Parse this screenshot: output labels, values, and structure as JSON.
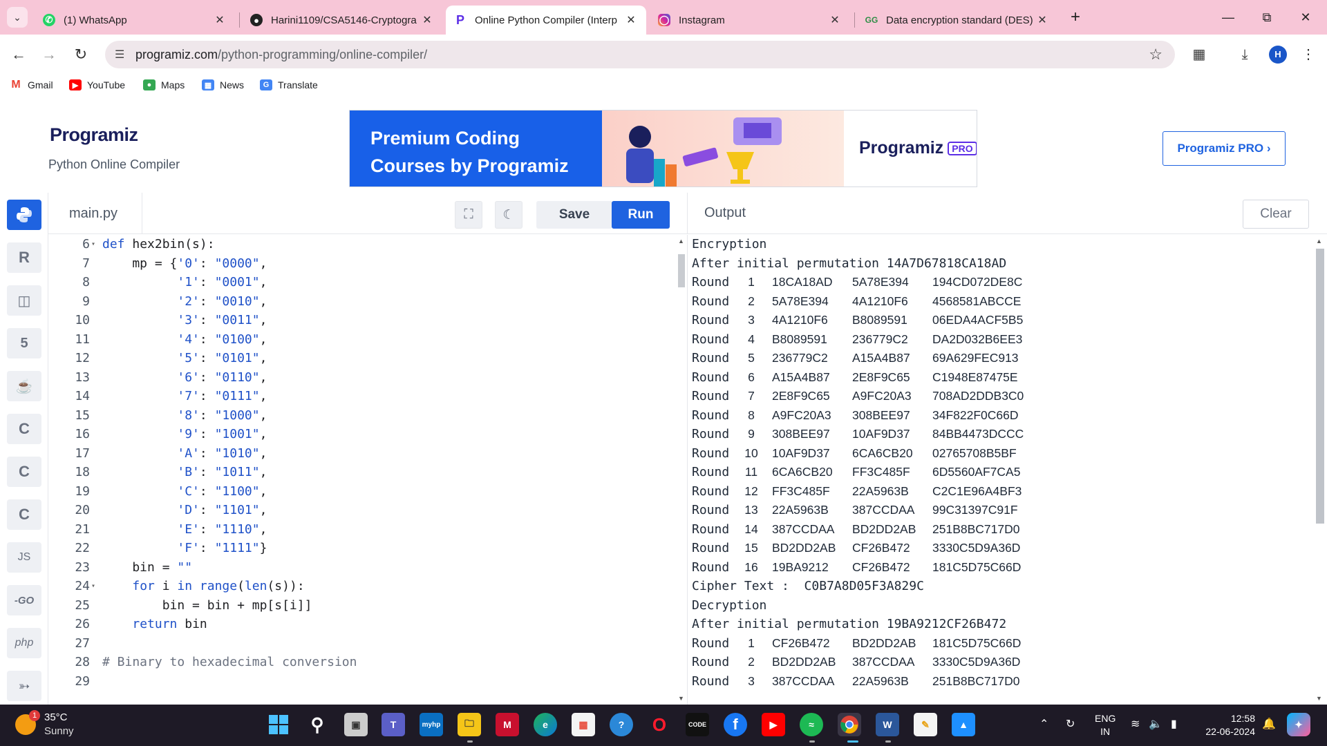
{
  "browser": {
    "tabs": [
      {
        "title": "(1) WhatsApp",
        "icon": "whatsapp-icon"
      },
      {
        "title": "Harini1109/CSA5146-Cryptogra",
        "icon": "github-icon"
      },
      {
        "title": "Online Python Compiler (Interp",
        "icon": "programiz-icon"
      },
      {
        "title": "Instagram",
        "icon": "instagram-icon"
      },
      {
        "title": "Data encryption standard (DES)",
        "icon": "geeks-icon"
      }
    ],
    "url_host": "programiz.com",
    "url_path": "/python-programming/online-compiler/",
    "profile_initial": "H",
    "bookmarks": [
      "Gmail",
      "YouTube",
      "Maps",
      "News",
      "Translate"
    ]
  },
  "header": {
    "logo": "Programiz",
    "subtitle": "Python Online Compiler",
    "banner_line1": "Premium Coding",
    "banner_line2": "Courses by Programiz",
    "banner_logo": "Programiz",
    "banner_pro": "PRO",
    "pro_button": "Programiz PRO ›"
  },
  "sidebar": {
    "items": [
      "python-icon",
      "r-icon",
      "database-icon",
      "html-icon",
      "java-icon",
      "c-icon",
      "cpp-icon",
      "csharp-icon",
      "js-icon",
      "go-icon",
      "php-icon",
      "swift-icon"
    ],
    "js_label": "JS",
    "go_label": "-GO",
    "php_label": "php"
  },
  "editor": {
    "filename": "main.py",
    "save_label": "Save",
    "run_label": "Run",
    "lines": [
      {
        "n": "6",
        "html": "<span class=\"kw\">def</span> hex2bin(s):",
        "fold": true
      },
      {
        "n": "7",
        "html": "    mp = {<span class=\"str\">'0'</span>: <span class=\"str\">\"0000\"</span>,"
      },
      {
        "n": "8",
        "html": "          <span class=\"str\">'1'</span>: <span class=\"str\">\"0001\"</span>,"
      },
      {
        "n": "9",
        "html": "          <span class=\"str\">'2'</span>: <span class=\"str\">\"0010\"</span>,"
      },
      {
        "n": "10",
        "html": "          <span class=\"str\">'3'</span>: <span class=\"str\">\"0011\"</span>,"
      },
      {
        "n": "11",
        "html": "          <span class=\"str\">'4'</span>: <span class=\"str\">\"0100\"</span>,"
      },
      {
        "n": "12",
        "html": "          <span class=\"str\">'5'</span>: <span class=\"str\">\"0101\"</span>,"
      },
      {
        "n": "13",
        "html": "          <span class=\"str\">'6'</span>: <span class=\"str\">\"0110\"</span>,"
      },
      {
        "n": "14",
        "html": "          <span class=\"str\">'7'</span>: <span class=\"str\">\"0111\"</span>,"
      },
      {
        "n": "15",
        "html": "          <span class=\"str\">'8'</span>: <span class=\"str\">\"1000\"</span>,"
      },
      {
        "n": "16",
        "html": "          <span class=\"str\">'9'</span>: <span class=\"str\">\"1001\"</span>,"
      },
      {
        "n": "17",
        "html": "          <span class=\"str\">'A'</span>: <span class=\"str\">\"1010\"</span>,"
      },
      {
        "n": "18",
        "html": "          <span class=\"str\">'B'</span>: <span class=\"str\">\"1011\"</span>,"
      },
      {
        "n": "19",
        "html": "          <span class=\"str\">'C'</span>: <span class=\"str\">\"1100\"</span>,"
      },
      {
        "n": "20",
        "html": "          <span class=\"str\">'D'</span>: <span class=\"str\">\"1101\"</span>,"
      },
      {
        "n": "21",
        "html": "          <span class=\"str\">'E'</span>: <span class=\"str\">\"1110\"</span>,"
      },
      {
        "n": "22",
        "html": "          <span class=\"str\">'F'</span>: <span class=\"str\">\"1111\"</span>}"
      },
      {
        "n": "23",
        "html": "    bin = <span class=\"str\">\"\"</span>"
      },
      {
        "n": "24",
        "html": "    <span class=\"kw\">for</span> i <span class=\"kw\">in</span> <span class=\"kw\">range</span>(<span class=\"kw\">len</span>(s)):",
        "fold": true
      },
      {
        "n": "25",
        "html": "        bin = bin + mp[s[i]]"
      },
      {
        "n": "26",
        "html": "    <span class=\"kw\">return</span> bin"
      },
      {
        "n": "27",
        "html": ""
      },
      {
        "n": "28",
        "html": "<span class=\"cm\"># Binary to hexadecimal conversion</span>"
      },
      {
        "n": "29",
        "html": ""
      }
    ]
  },
  "output": {
    "title": "Output",
    "clear_label": "Clear",
    "encryption_label": "Encryption",
    "enc_initial_perm": "After initial permutation 14A7D67818CA18AD",
    "enc_rounds": [
      [
        "1",
        "18CA18AD",
        "5A78E394",
        "194CD072DE8C"
      ],
      [
        "2",
        "5A78E394",
        "4A1210F6",
        "4568581ABCCE"
      ],
      [
        "3",
        "4A1210F6",
        "B8089591",
        "06EDA4ACF5B5"
      ],
      [
        "4",
        "B8089591",
        "236779C2",
        "DA2D032B6EE3"
      ],
      [
        "5",
        "236779C2",
        "A15A4B87",
        "69A629FEC913"
      ],
      [
        "6",
        "A15A4B87",
        "2E8F9C65",
        "C1948E87475E"
      ],
      [
        "7",
        "2E8F9C65",
        "A9FC20A3",
        "708AD2DDB3C0"
      ],
      [
        "8",
        "A9FC20A3",
        "308BEE97",
        "34F822F0C66D"
      ],
      [
        "9",
        "308BEE97",
        "10AF9D37",
        "84BB4473DCCC"
      ],
      [
        "10",
        "10AF9D37",
        "6CA6CB20",
        "02765708B5BF"
      ],
      [
        "11",
        "6CA6CB20",
        "FF3C485F",
        "6D5560AF7CA5"
      ],
      [
        "12",
        "FF3C485F",
        "22A5963B",
        "C2C1E96A4BF3"
      ],
      [
        "13",
        "22A5963B",
        "387CCDAA",
        "99C31397C91F"
      ],
      [
        "14",
        "387CCDAA",
        "BD2DD2AB",
        "251B8BC717D0"
      ],
      [
        "15",
        "BD2DD2AB",
        "CF26B472",
        "3330C5D9A36D"
      ],
      [
        "16",
        "19BA9212",
        "CF26B472",
        "181C5D75C66D"
      ]
    ],
    "cipher_text": "Cipher Text :  C0B7A8D05F3A829C",
    "decryption_label": "Decryption",
    "dec_initial_perm": "After initial permutation 19BA9212CF26B472",
    "dec_rounds": [
      [
        "1",
        "CF26B472",
        "BD2DD2AB",
        "181C5D75C66D"
      ],
      [
        "2",
        "BD2DD2AB",
        "387CCDAA",
        "3330C5D9A36D"
      ],
      [
        "3",
        "387CCDAA",
        "22A5963B",
        "251B8BC717D0"
      ]
    ],
    "round_word": "Round"
  },
  "taskbar": {
    "temperature": "35°C",
    "condition": "Sunny",
    "weather_badge": "1",
    "lang_line1": "ENG",
    "lang_line2": "IN",
    "time": "12:58",
    "date": "22-06-2024"
  }
}
